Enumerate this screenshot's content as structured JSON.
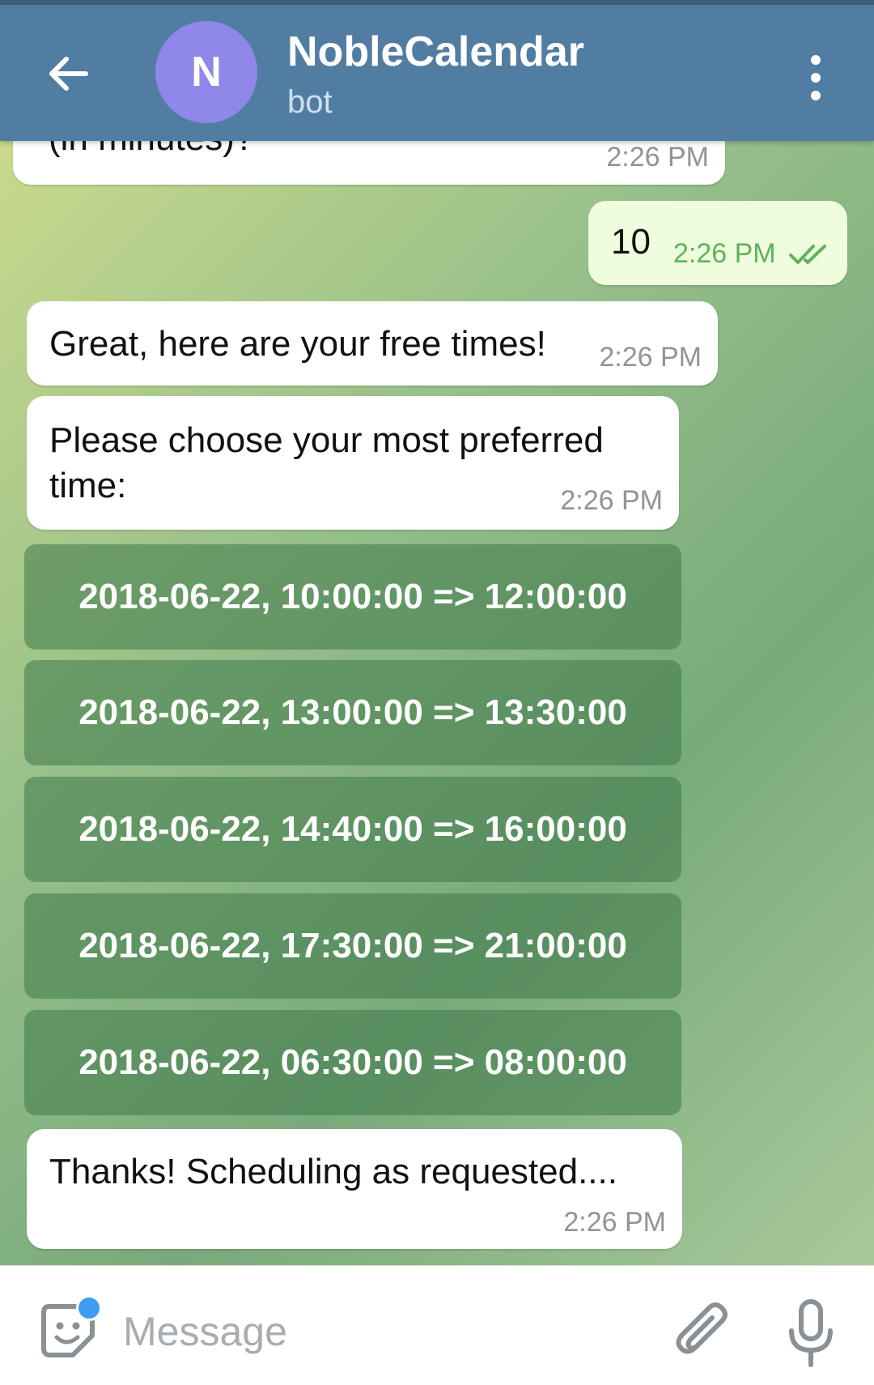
{
  "header": {
    "avatar_letter": "N",
    "title": "NobleCalendar",
    "subtitle": "bot",
    "avatar_color": "#8f87ea",
    "bar_color": "#527da3"
  },
  "messages": [
    {
      "text": "(in minutes)?",
      "time": "2:26 PM",
      "direction": "incoming"
    },
    {
      "text": "10",
      "time": "2:26 PM",
      "direction": "outgoing",
      "status": "read"
    },
    {
      "text": "Great, here are your free times!",
      "time": "2:26 PM",
      "direction": "incoming"
    },
    {
      "text_line1": "Please choose your most preferred",
      "text_line2": "time:",
      "time": "2:26 PM",
      "direction": "incoming"
    },
    {
      "text": "Thanks! Scheduling as requested....",
      "time": "2:26 PM",
      "direction": "incoming"
    }
  ],
  "keyboard_buttons": [
    "2018-06-22, 10:00:00 => 12:00:00",
    "2018-06-22, 13:00:00 => 13:30:00",
    "2018-06-22, 14:40:00 => 16:00:00",
    "2018-06-22, 17:30:00 => 21:00:00",
    "2018-06-22, 06:30:00 => 08:00:00"
  ],
  "input": {
    "placeholder": "Message"
  },
  "icons": {
    "back": "back-arrow-icon",
    "menu": "more-vertical-icon",
    "emoji": "emoji-sticker-icon",
    "attach": "paperclip-icon",
    "mic": "microphone-icon",
    "read_receipt": "double-check-icon"
  }
}
